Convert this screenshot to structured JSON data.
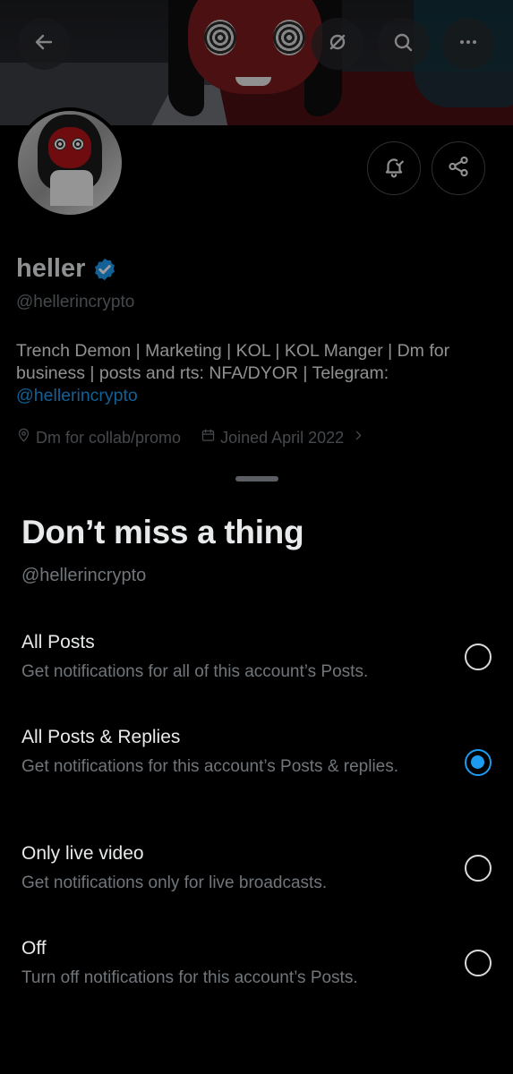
{
  "profile": {
    "display_name": "heller",
    "handle": "@hellerincrypto",
    "bio_text": "Trench Demon | Marketing | KOL | KOL Manger | Dm for business | posts and rts: NFA/DYOR | Telegram:",
    "bio_link": "@hellerincrypto",
    "location": "Dm for collab/promo",
    "joined": "Joined April 2022",
    "accent_color": "#1d9bf0"
  },
  "icons": {
    "back": "arrow-left-icon",
    "grok": "grok-icon",
    "search": "search-icon",
    "more": "more-icon",
    "notify": "bell-check-icon",
    "share": "share-icon",
    "verified": "verified-badge-icon",
    "location": "location-pin-icon",
    "calendar": "calendar-icon",
    "chevron": "chevron-right-icon"
  },
  "sheet": {
    "title": "Don’t miss a thing",
    "subtitle": "@hellerincrypto",
    "options": [
      {
        "title": "All Posts",
        "description": "Get notifications for all of this account’s Posts.",
        "selected": false
      },
      {
        "title": "All Posts & Replies",
        "description": "Get notifications for this account’s Posts & replies.",
        "selected": true
      },
      {
        "title": "Only live video",
        "description": "Get notifications only for live broadcasts.",
        "selected": false
      },
      {
        "title": "Off",
        "description": "Turn off notifications for this account’s Posts.",
        "selected": false
      }
    ]
  }
}
